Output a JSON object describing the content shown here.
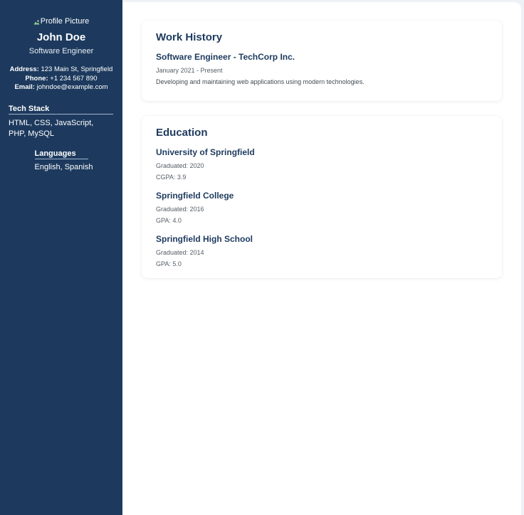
{
  "sidebar": {
    "profile_picture_alt": "Profile Picture",
    "name": "John Doe",
    "role": "Software Engineer",
    "contact": {
      "address_label": "Address:",
      "address_value": "123 Main St, Springfield",
      "phone_label": "Phone:",
      "phone_value": "+1 234 567 890",
      "email_label": "Email:",
      "email_value": "johndoe@example.com"
    },
    "tech_stack": {
      "title": "Tech Stack",
      "items": "HTML, CSS, JavaScript, PHP, MySQL"
    },
    "languages": {
      "title": "Languages",
      "items": "English, Spanish"
    }
  },
  "main": {
    "work_history": {
      "title": "Work History",
      "entries": [
        {
          "title": "Software Engineer - TechCorp Inc.",
          "dates": "January 2021 - Present",
          "description": "Developing and maintaining web applications using modern technologies."
        }
      ]
    },
    "education": {
      "title": "Education",
      "entries": [
        {
          "school": "University of Springfield",
          "graduated": "Graduated: 2020",
          "grade": "CGPA: 3.9"
        },
        {
          "school": "Springfield College",
          "graduated": "Graduated: 2016",
          "grade": "GPA: 4.0"
        },
        {
          "school": "Springfield High School",
          "graduated": "Graduated: 2014",
          "grade": "GPA: 5.0"
        }
      ]
    }
  },
  "colors": {
    "sidebar_bg": "#1d3a5e",
    "heading": "#1d3a5e",
    "page_bg": "#eef1f6"
  }
}
